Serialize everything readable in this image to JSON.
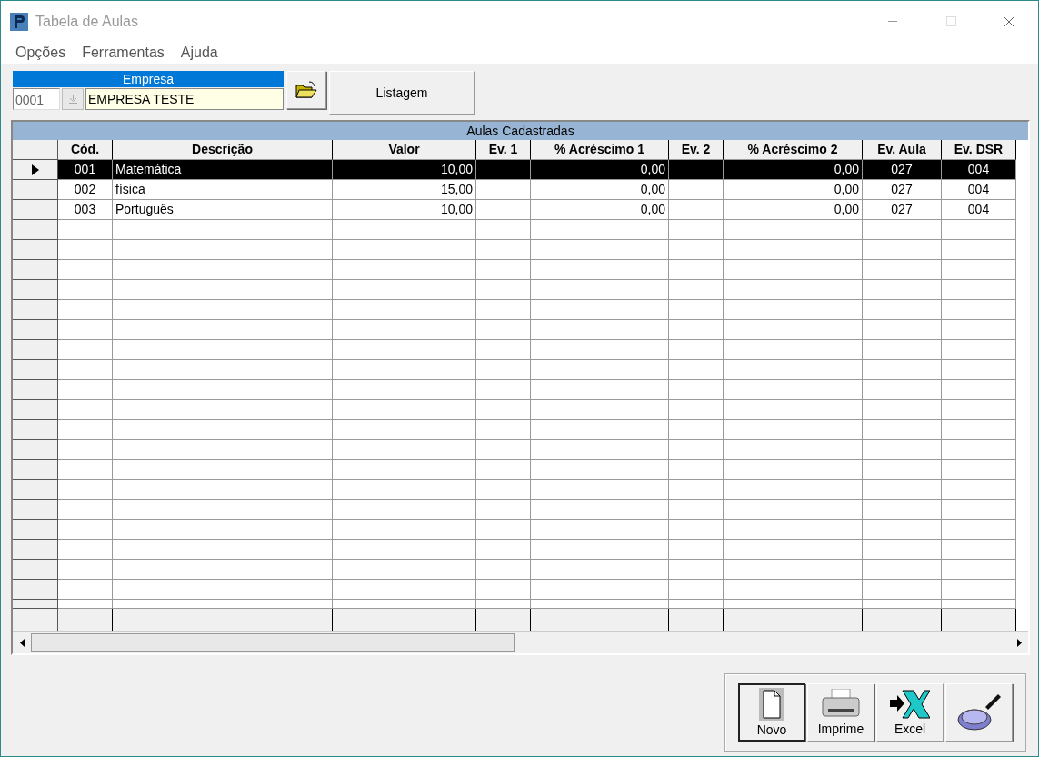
{
  "window": {
    "title": "Tabela de Aulas"
  },
  "menu": [
    "Opções",
    "Ferramentas",
    "Ajuda"
  ],
  "empresa": {
    "label": "Empresa",
    "code": "0001",
    "name": "EMPRESA TESTE"
  },
  "listagem_button": "Listagem",
  "table": {
    "title": "Aulas Cadastradas",
    "columns": [
      "Cód.",
      "Descrição",
      "Valor",
      "Ev. 1",
      "% Acréscimo 1",
      "Ev. 2",
      "% Acréscimo 2",
      "Ev. Aula",
      "Ev. DSR"
    ],
    "rows": [
      {
        "selected": true,
        "cells": [
          "001",
          "Matemática",
          "10,00",
          "",
          "0,00",
          "",
          "0,00",
          "027",
          "004"
        ]
      },
      {
        "selected": false,
        "cells": [
          "002",
          "física",
          "15,00",
          "",
          "0,00",
          "",
          "0,00",
          "027",
          "004"
        ]
      },
      {
        "selected": false,
        "cells": [
          "003",
          "Português",
          "10,00",
          "",
          "0,00",
          "",
          "0,00",
          "027",
          "004"
        ]
      }
    ]
  },
  "toolbar": [
    {
      "kind": "new",
      "label": "Novo"
    },
    {
      "kind": "print",
      "label": "Imprime"
    },
    {
      "kind": "excel",
      "label": "Excel"
    },
    {
      "kind": "search"
    }
  ]
}
